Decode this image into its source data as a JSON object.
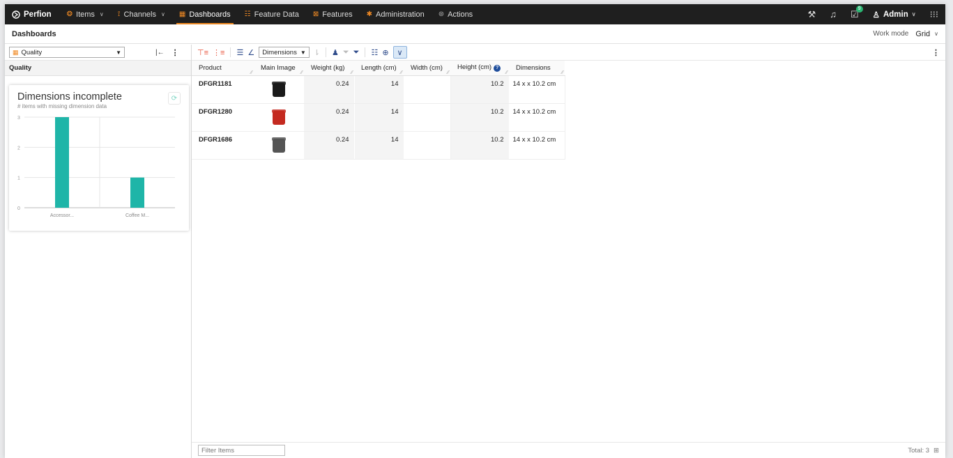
{
  "nav": {
    "brand": "Perfion",
    "items": [
      {
        "label": "Items",
        "icon": "item-icon",
        "chevron": true
      },
      {
        "label": "Channels",
        "icon": "channel-icon",
        "chevron": true
      },
      {
        "label": "Dashboards",
        "icon": "dashboard-icon",
        "active": true
      },
      {
        "label": "Feature Data",
        "icon": "feature-data-icon"
      },
      {
        "label": "Features",
        "icon": "features-icon"
      },
      {
        "label": "Administration",
        "icon": "gear-icon"
      },
      {
        "label": "Actions",
        "icon": "actions-icon"
      }
    ],
    "task_badge": "9",
    "user": "Admin"
  },
  "page": {
    "title": "Dashboards",
    "work_mode_label": "Work mode",
    "work_mode_value": "Grid"
  },
  "left": {
    "selector": "Quality",
    "section": "Quality",
    "card": {
      "title": "Dimensions incomplete",
      "subtitle": "# items with missing dimension data"
    }
  },
  "chart_data": {
    "type": "bar",
    "categories": [
      "Accessor...",
      "Coffee M..."
    ],
    "values": [
      3,
      1
    ],
    "ylim": [
      0,
      3
    ],
    "yticks": [
      0,
      1,
      2,
      3
    ],
    "color": "#1fb5a8",
    "grid": true
  },
  "toolbar": {
    "view_select": "Dimensions"
  },
  "grid": {
    "columns": [
      "Product",
      "Main Image",
      "Weight (kg)",
      "Length (cm)",
      "Width (cm)",
      "Height (cm)",
      "Dimensions"
    ],
    "rows": [
      {
        "product": "DFGR1181",
        "image_color": "#1a1a1a",
        "weight": "0.24",
        "length": "14",
        "width": "",
        "height": "10.2",
        "dimensions": "14 x x 10.2 cm"
      },
      {
        "product": "DFGR1280",
        "image_color": "#c42a20",
        "weight": "0.24",
        "length": "14",
        "width": "",
        "height": "10.2",
        "dimensions": "14 x x 10.2 cm"
      },
      {
        "product": "DFGR1686",
        "image_color": "#555555",
        "weight": "0.24",
        "length": "14",
        "width": "",
        "height": "10.2",
        "dimensions": "14 x x 10.2 cm"
      }
    ],
    "filter_placeholder": "Filter Items",
    "total": "Total: 3"
  }
}
